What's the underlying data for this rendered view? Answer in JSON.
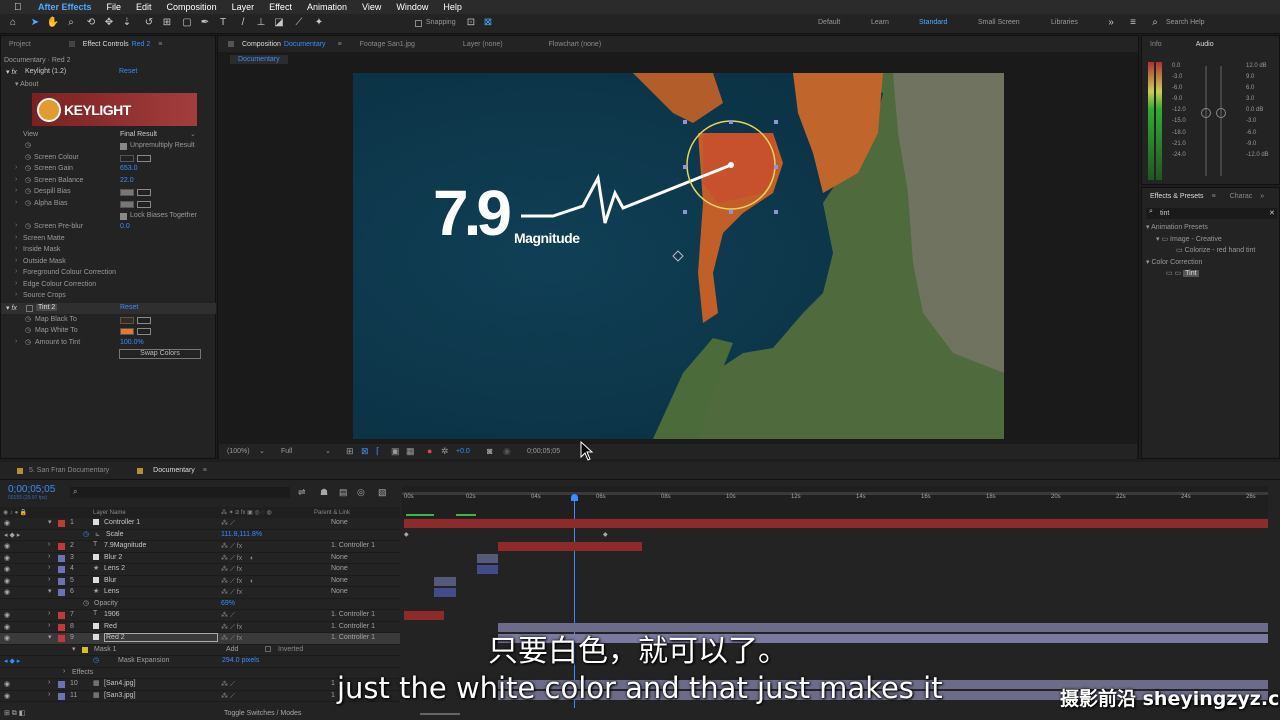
{
  "menubar": {
    "apple": "",
    "items": [
      "After Effects",
      "File",
      "Edit",
      "Composition",
      "Layer",
      "Effect",
      "Animation",
      "View",
      "Window",
      "Help"
    ]
  },
  "toolbar": {
    "snapping": "Snapping",
    "workspaces": [
      "Default",
      "Learn",
      "Standard",
      "Small Screen",
      "Libraries"
    ],
    "search_placeholder": "Search Help"
  },
  "left_panel": {
    "tabs": [
      "Project",
      "Effect Controls",
      "Red 2"
    ],
    "breadcrumb": "Documentary · Red 2",
    "effect1": {
      "name": "Keylight (1.2)",
      "reset": "Reset",
      "about": "About",
      "logo": "KEYLIGHT"
    },
    "rows": [
      {
        "label": "View",
        "value": "Final Result"
      },
      {
        "label": "",
        "value": "Unpremultiply Result"
      },
      {
        "label": "Screen Colour",
        "value": ""
      },
      {
        "label": "Screen Gain",
        "value": "653.0"
      },
      {
        "label": "Screen Balance",
        "value": "22.0"
      },
      {
        "label": "Despill Bias",
        "value": ""
      },
      {
        "label": "Alpha Bias",
        "value": ""
      },
      {
        "label": "",
        "value": "Lock Biases Together"
      },
      {
        "label": "Screen Pre-blur",
        "value": "0.0"
      },
      {
        "label": "Screen Matte",
        "value": ""
      },
      {
        "label": "Inside Mask",
        "value": ""
      },
      {
        "label": "Outside Mask",
        "value": ""
      },
      {
        "label": "Foreground Colour Correction",
        "value": ""
      },
      {
        "label": "Edge Colour Correction",
        "value": ""
      },
      {
        "label": "Source Crops",
        "value": ""
      }
    ],
    "effect2": {
      "name": "Tint 2",
      "reset": "Reset"
    },
    "tint_rows": [
      {
        "label": "Map Black To",
        "value": ""
      },
      {
        "label": "Map White To",
        "value": ""
      },
      {
        "label": "Amount to Tint",
        "value": "100.0%"
      }
    ],
    "swap_button": "Swap Colors"
  },
  "viewer": {
    "tabs": [
      "Composition",
      "Documentary",
      "Footage San1.jpg",
      "Layer (none)",
      "Flowchart (none)"
    ],
    "subtab": "Documentary",
    "bottom": {
      "zoom": "(100%)",
      "res": "Full",
      "exposure": "+0.0",
      "timecode": "0;00;05;05"
    },
    "overlay": {
      "big": "7.9",
      "small": "Magnitude"
    }
  },
  "right_panel": {
    "info_tabs": [
      "Info",
      "Audio"
    ],
    "db_left": [
      "0.0",
      "-3.0",
      "-6.0",
      "-9.0",
      "-12.0",
      "-15.0",
      "-18.0",
      "-21.0",
      "-24.0"
    ],
    "db_right": [
      "12.0 dB",
      "9.0",
      "6.0",
      "3.0",
      "0.0 dB",
      "-3.0",
      "-6.0",
      "-9.0",
      "-12.0 dB"
    ],
    "effects_tabs": [
      "Effects & Presets",
      "Charac"
    ],
    "search": "tint",
    "tree": [
      "Animation Presets",
      "Image - Creative",
      "Colorize - red hand tint",
      "Color Correction",
      "Tint"
    ]
  },
  "timeline": {
    "tabs": [
      "5. San Fran Documentary",
      "Documentary"
    ],
    "timecode": "0;00;05;05",
    "timecode_sub": "00155 (29.97 fps)",
    "col_layer": "Layer Name",
    "col_parent": "Parent & Link",
    "ruler": [
      "00s",
      "02s",
      "04s",
      "06s",
      "08s",
      "10s",
      "12s",
      "14s",
      "16s",
      "18s",
      "20s",
      "22s",
      "24s",
      "26s"
    ],
    "rows": [
      {
        "num": "1",
        "name": "Controller 1",
        "parent": "None",
        "color": "#c03a3a"
      },
      {
        "num": "",
        "name": "Scale",
        "parent": "",
        "value": "111.8,111.8%"
      },
      {
        "num": "2",
        "name": "7.9Magnitude",
        "parent": "1. Controller 1",
        "color": "#c03a3a"
      },
      {
        "num": "3",
        "name": "Blur 2",
        "parent": "None",
        "color": "#6c72b8"
      },
      {
        "num": "4",
        "name": "Lens 2",
        "parent": "None",
        "color": "#6c72b8"
      },
      {
        "num": "5",
        "name": "Blur",
        "parent": "None",
        "color": "#6c72b8"
      },
      {
        "num": "6",
        "name": "Lens",
        "parent": "None",
        "color": "#6c72b8"
      },
      {
        "num": "",
        "name": "Opacity",
        "parent": "",
        "value": "69%"
      },
      {
        "num": "7",
        "name": "1906",
        "parent": "1. Controller 1",
        "color": "#c03a3a"
      },
      {
        "num": "8",
        "name": "Red",
        "parent": "1. Controller 1",
        "color": "#c03a3a"
      },
      {
        "num": "9",
        "name": "Red 2",
        "parent": "1. Controller 1",
        "color": "#c03a3a"
      },
      {
        "num": "",
        "name": "Mask 1",
        "parent": "",
        "value": "Add"
      },
      {
        "num": "",
        "name": "Mask Expansion",
        "parent": "",
        "value": "294.0 pixels"
      },
      {
        "num": "",
        "name": "Effects",
        "parent": "",
        "value": ""
      },
      {
        "num": "10",
        "name": "[San4.jpg]",
        "parent": "1",
        "color": "#6c72b8"
      },
      {
        "num": "11",
        "name": "[San3.jpg]",
        "parent": "1",
        "color": "#6c72b8"
      }
    ],
    "inverted": "Inverted",
    "footer": "Toggle Switches / Modes"
  },
  "subtitles": {
    "zh": "只要白色，就可以了。",
    "en": "just the white color and that just makes it"
  },
  "watermark": "摄影前沿 sheyingzyz.com"
}
